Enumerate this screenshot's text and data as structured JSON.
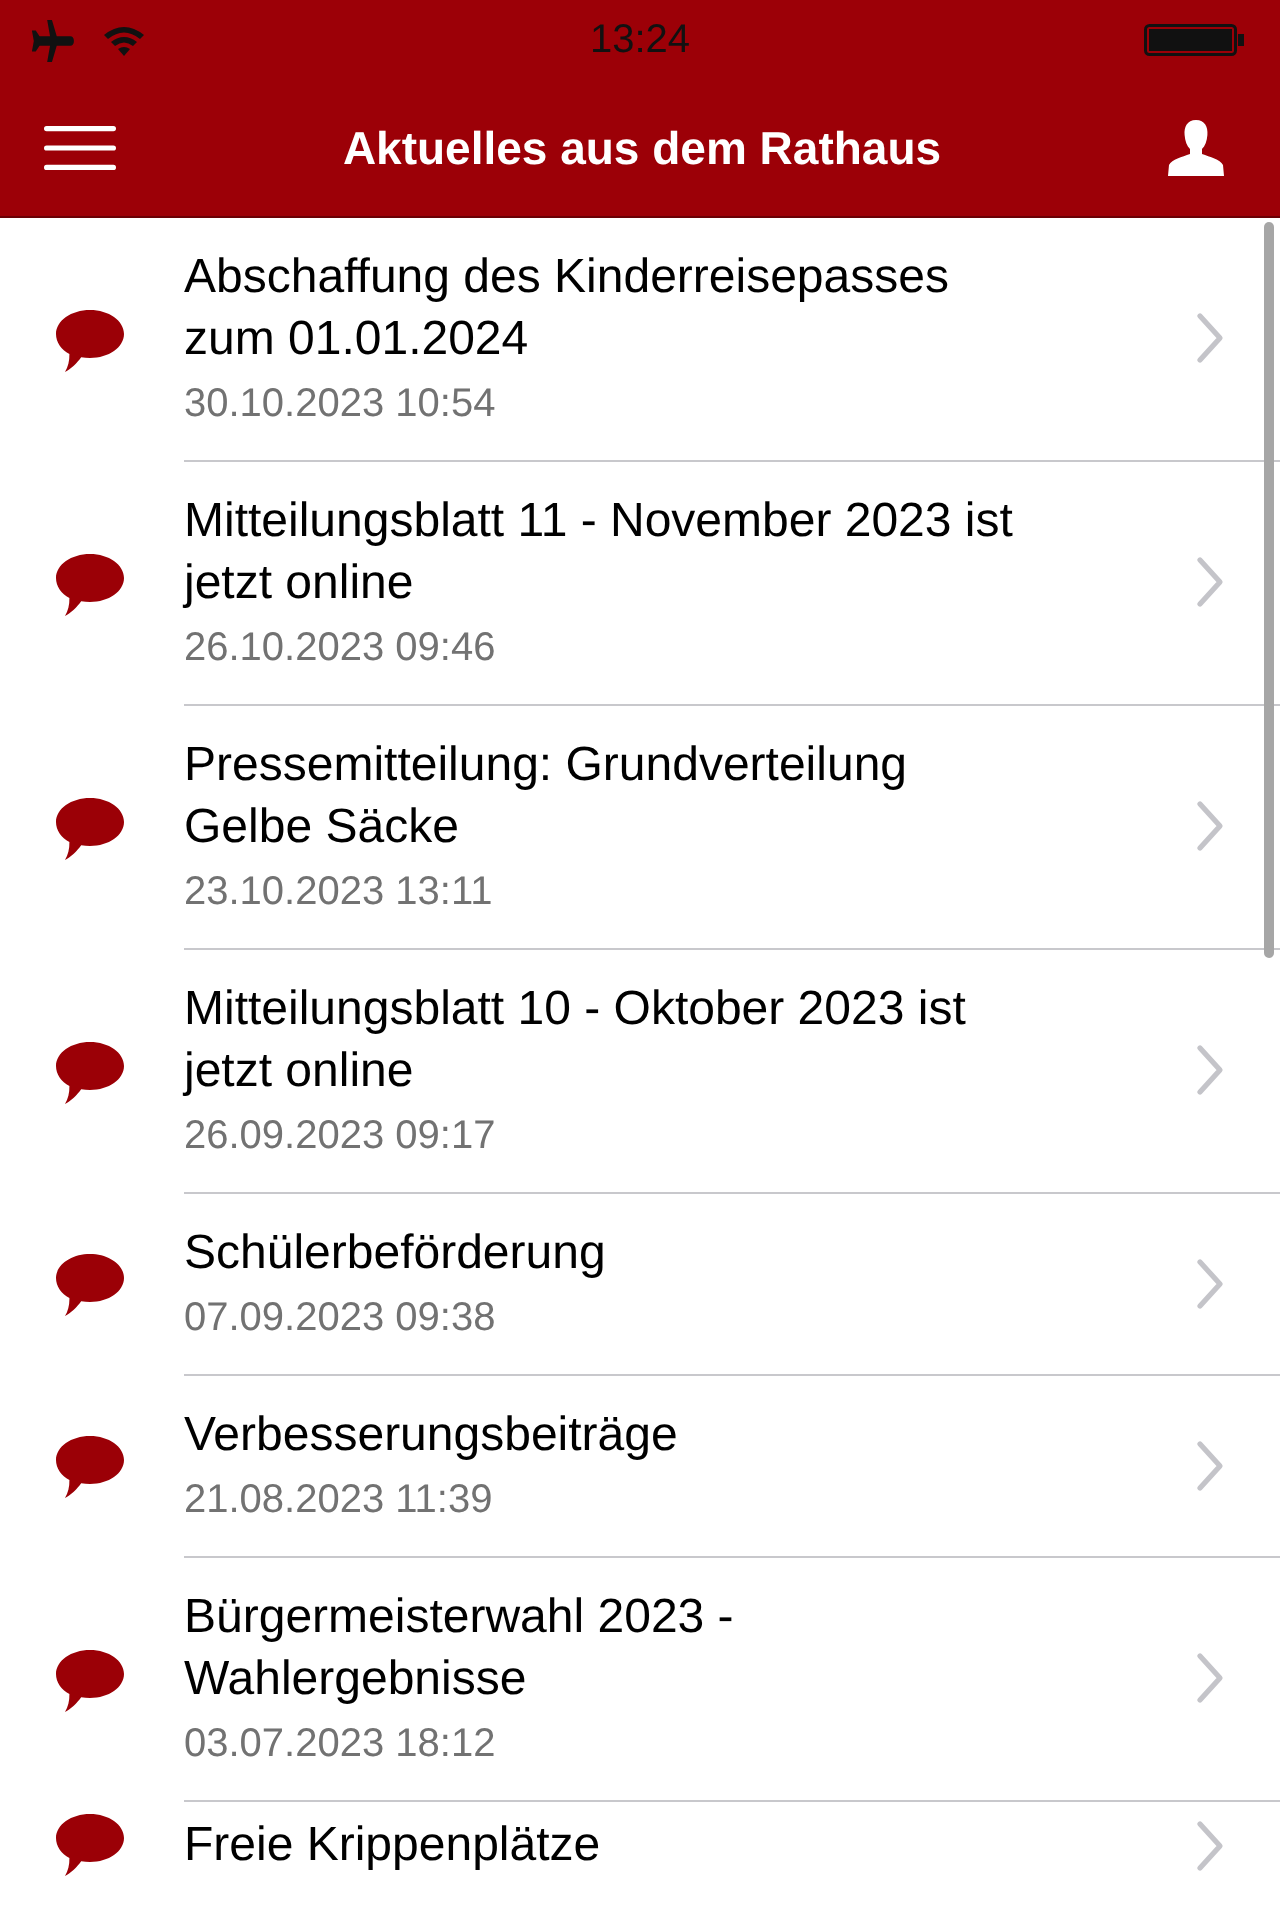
{
  "status_bar": {
    "time": "13:24"
  },
  "nav_bar": {
    "title": "Aktuelles aus dem Rathaus"
  },
  "news": [
    {
      "title_lines": [
        "Abschaffung des Kinderreisepasses",
        "zum 01.01.2024"
      ],
      "date": "30.10.2023 10:54"
    },
    {
      "title_lines": [
        "Mitteilungsblatt 11 - November 2023 ist",
        "jetzt online"
      ],
      "date": "26.10.2023 09:46"
    },
    {
      "title_lines": [
        "Pressemitteilung: Grundverteilung",
        "Gelbe Säcke"
      ],
      "date": "23.10.2023 13:11"
    },
    {
      "title_lines": [
        "Mitteilungsblatt 10 - Oktober 2023 ist",
        "jetzt online"
      ],
      "date": "26.09.2023 09:17"
    },
    {
      "title_lines": [
        "Schülerbeförderung"
      ],
      "date": "07.09.2023 09:38"
    },
    {
      "title_lines": [
        "Verbesserungsbeiträge"
      ],
      "date": "21.08.2023 11:39"
    },
    {
      "title_lines": [
        "Bürgermeisterwahl 2023 -",
        "Wahlergebnisse"
      ],
      "date": "03.07.2023 18:12"
    },
    {
      "title_lines": [
        "Freie Krippenplätze"
      ]
    }
  ]
}
